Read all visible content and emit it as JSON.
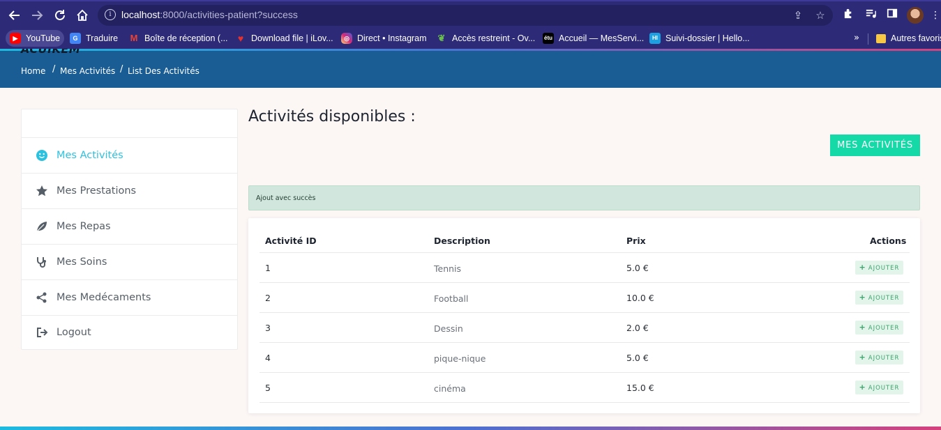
{
  "browser": {
    "url_host": "localhost",
    "url_rest": ":8000/activities-patient?success",
    "bookmarks": [
      {
        "label": "YouTube",
        "icon": "youtube-icon",
        "color": "#ff0000"
      },
      {
        "label": "Traduire",
        "icon": "translate-icon",
        "color": "#4285f4"
      },
      {
        "label": "Boîte de réception (...",
        "icon": "gmail-icon",
        "color": "#ea4335"
      },
      {
        "label": "Download file | iLov...",
        "icon": "heart-icon",
        "color": "#e5322d"
      },
      {
        "label": "Direct • Instagram",
        "icon": "instagram-icon",
        "color": "#d6249f"
      },
      {
        "label": "Accès restreint - Ov...",
        "icon": "leaf-icon",
        "color": "#4caf50"
      },
      {
        "label": "Accueil — MesServi...",
        "icon": "etu-icon",
        "color": "#000000"
      },
      {
        "label": "Suivi-dossier | Hello...",
        "icon": "hi-icon",
        "color": "#1ba1e2"
      }
    ],
    "more_label": "»",
    "other_bookmarks": "Autres favoris"
  },
  "header": {
    "logo_text": "ACUIKEM",
    "breadcrumb": [
      "Home",
      "Mes Activités",
      "List Des Activités"
    ]
  },
  "sidebar": {
    "items": [
      {
        "label": "Mes Activités",
        "icon": "smile-icon",
        "active": true
      },
      {
        "label": "Mes Prestations",
        "icon": "star-icon",
        "active": false
      },
      {
        "label": "Mes Repas",
        "icon": "leaf-icon",
        "active": false
      },
      {
        "label": "Mes Soins",
        "icon": "stethoscope-icon",
        "active": false
      },
      {
        "label": "Mes Medécaments",
        "icon": "share-icon",
        "active": false
      },
      {
        "label": "Logout",
        "icon": "logout-icon",
        "active": false
      }
    ]
  },
  "main": {
    "title": "Activités disponibles :",
    "mes_activites_button": "MES ACTIVITÉS",
    "alert": "Ajout avec succès",
    "table": {
      "headers": [
        "Activité ID",
        "Description",
        "Prix",
        "Actions"
      ],
      "add_label": "AJOUTER",
      "rows": [
        {
          "id": "1",
          "description": "Tennis",
          "prix": "5.0 €"
        },
        {
          "id": "2",
          "description": "Football",
          "prix": "10.0 €"
        },
        {
          "id": "3",
          "description": "Dessin",
          "prix": "2.0 €"
        },
        {
          "id": "4",
          "description": "pique-nique",
          "prix": "5.0 €"
        },
        {
          "id": "5",
          "description": "cinéma",
          "prix": "15.0 €"
        }
      ]
    }
  },
  "colors": {
    "accent": "#16d9a8",
    "header": "#1a5d94",
    "active_link": "#2dc1e0",
    "browser": "#2d2b78"
  }
}
